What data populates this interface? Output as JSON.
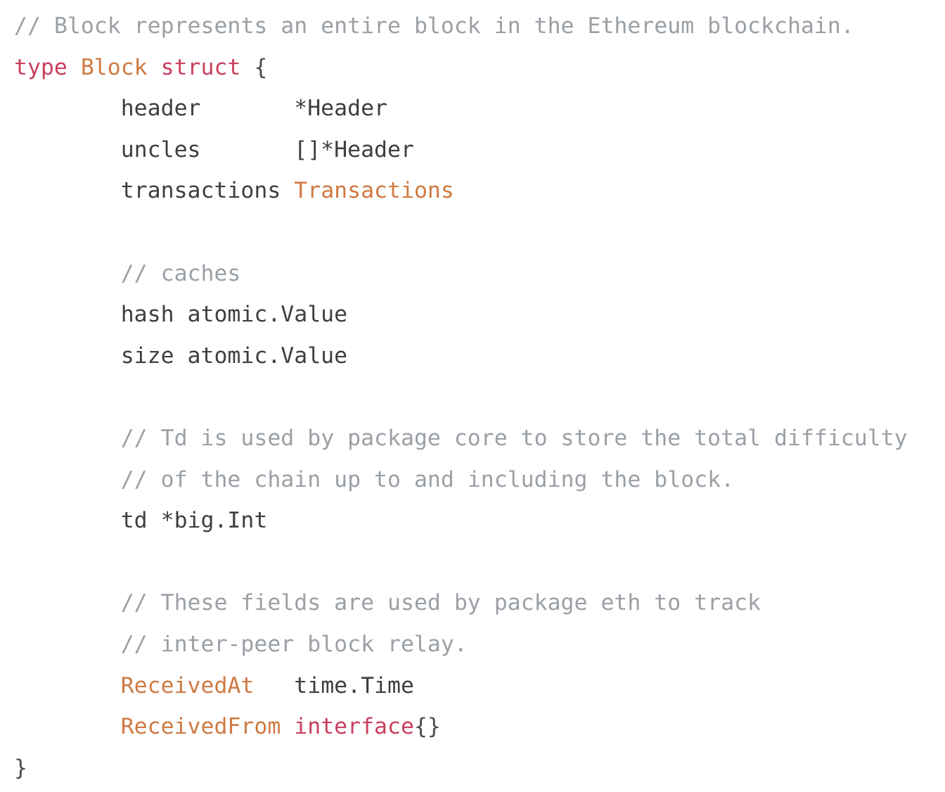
{
  "editor": {
    "language": "go",
    "background": "#ffffff",
    "colors": {
      "comment": "#9aa0a6",
      "keyword": "#c9405e",
      "type": "#cf7a42",
      "identifier": "#3c3f41",
      "punctuation": "#4a4d50"
    }
  },
  "code": {
    "lines": [
      {
        "id": "l1",
        "text": "// Block represents an entire block in the Ethereum blockchain.",
        "tokens": [
          {
            "t": "// Block represents an entire block in the Ethereum blockchain.",
            "c": "comment"
          }
        ]
      },
      {
        "id": "l2",
        "text": "type Block struct {",
        "tokens": [
          {
            "t": "type",
            "c": "keyword"
          },
          {
            "t": " ",
            "c": "plain"
          },
          {
            "t": "Block",
            "c": "type"
          },
          {
            "t": " ",
            "c": "plain"
          },
          {
            "t": "struct",
            "c": "keyword"
          },
          {
            "t": " ",
            "c": "plain"
          },
          {
            "t": "{",
            "c": "punct"
          }
        ]
      },
      {
        "id": "l3",
        "text": "        header       *Header",
        "tokens": [
          {
            "t": "        header       *Header",
            "c": "ident"
          }
        ]
      },
      {
        "id": "l4",
        "text": "        uncles       []*Header",
        "tokens": [
          {
            "t": "        uncles       []*Header",
            "c": "ident"
          }
        ]
      },
      {
        "id": "l5",
        "text": "        transactions Transactions",
        "tokens": [
          {
            "t": "        transactions ",
            "c": "ident"
          },
          {
            "t": "Transactions",
            "c": "type"
          }
        ]
      },
      {
        "id": "l6",
        "text": "",
        "tokens": []
      },
      {
        "id": "l7",
        "text": "        // caches",
        "tokens": [
          {
            "t": "        ",
            "c": "plain"
          },
          {
            "t": "// caches",
            "c": "comment"
          }
        ]
      },
      {
        "id": "l8",
        "text": "        hash atomic.Value",
        "tokens": [
          {
            "t": "        hash atomic.Value",
            "c": "ident"
          }
        ]
      },
      {
        "id": "l9",
        "text": "        size atomic.Value",
        "tokens": [
          {
            "t": "        size atomic.Value",
            "c": "ident"
          }
        ]
      },
      {
        "id": "l10",
        "text": "",
        "tokens": []
      },
      {
        "id": "l11",
        "text": "        // Td is used by package core to store the total difficulty",
        "tokens": [
          {
            "t": "        ",
            "c": "plain"
          },
          {
            "t": "// Td is used by package core to store the total difficulty",
            "c": "comment"
          }
        ]
      },
      {
        "id": "l12",
        "text": "        // of the chain up to and including the block.",
        "tokens": [
          {
            "t": "        ",
            "c": "plain"
          },
          {
            "t": "// of the chain up to and including the block.",
            "c": "comment"
          }
        ]
      },
      {
        "id": "l13",
        "text": "        td *big.Int",
        "tokens": [
          {
            "t": "        td *big.Int",
            "c": "ident"
          }
        ]
      },
      {
        "id": "l14",
        "text": "",
        "tokens": []
      },
      {
        "id": "l15",
        "text": "        // These fields are used by package eth to track",
        "tokens": [
          {
            "t": "        ",
            "c": "plain"
          },
          {
            "t": "// These fields are used by package eth to track",
            "c": "comment"
          }
        ]
      },
      {
        "id": "l16",
        "text": "        // inter-peer block relay.",
        "tokens": [
          {
            "t": "        ",
            "c": "plain"
          },
          {
            "t": "// inter-peer block relay.",
            "c": "comment"
          }
        ]
      },
      {
        "id": "l17",
        "text": "        ReceivedAt   time.Time",
        "tokens": [
          {
            "t": "        ",
            "c": "plain"
          },
          {
            "t": "ReceivedAt",
            "c": "type"
          },
          {
            "t": "   time.Time",
            "c": "ident"
          }
        ]
      },
      {
        "id": "l18",
        "text": "        ReceivedFrom interface{}",
        "tokens": [
          {
            "t": "        ",
            "c": "plain"
          },
          {
            "t": "ReceivedFrom",
            "c": "type"
          },
          {
            "t": " ",
            "c": "plain"
          },
          {
            "t": "interface",
            "c": "keyword"
          },
          {
            "t": "{}",
            "c": "punct"
          }
        ]
      },
      {
        "id": "l19",
        "text": "}",
        "tokens": [
          {
            "t": "}",
            "c": "punct"
          }
        ]
      }
    ]
  }
}
